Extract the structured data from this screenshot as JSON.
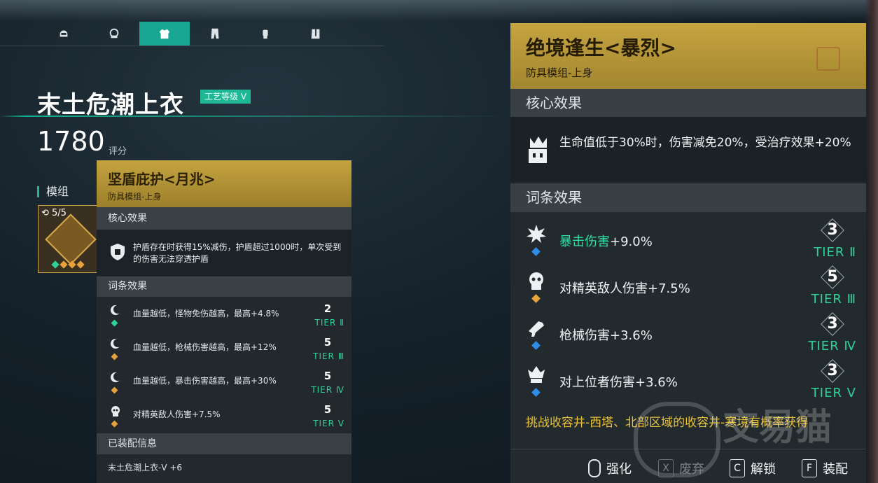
{
  "tabs": [
    {
      "icon": "helmet-icon"
    },
    {
      "icon": "mask-icon"
    },
    {
      "icon": "top-armor-icon",
      "active": true
    },
    {
      "icon": "pants-icon"
    },
    {
      "icon": "gloves-icon"
    },
    {
      "icon": "boots-icon"
    }
  ],
  "item": {
    "title": "末土危潮上衣",
    "craft_badge": "工艺等级 V",
    "score": "1780",
    "score_label": "评分",
    "module_label": "模组",
    "module_count": "5/5"
  },
  "left_popup": {
    "title": "坚盾庇护<月兆>",
    "subtitle": "防具模组-上身",
    "core_header": "核心效果",
    "core_text": "护盾存在时获得15%减伤，护盾超过1000时，单次受到的伤害无法穿透护盾",
    "affix_header": "词条效果",
    "affixes": [
      {
        "text": "血量越低，怪物免伤越高，最高+4.8%",
        "num": "2",
        "tier": "TIER Ⅱ",
        "color": "#2fd19a"
      },
      {
        "text": "血量越低，枪械伤害越高，最高+12%",
        "num": "5",
        "tier": "TIER Ⅲ",
        "color": "#e8a23a"
      },
      {
        "text": "血量越低，暴击伤害越高，最高+30%",
        "num": "5",
        "tier": "TIER Ⅳ",
        "color": "#e8a23a"
      },
      {
        "text": "对精英敌人伤害+7.5%",
        "num": "5",
        "tier": "TIER Ⅴ",
        "color": "#e8a23a"
      }
    ],
    "equip_header": "已装配信息",
    "equip_text": "末土危潮上衣-V +6"
  },
  "right_popup": {
    "title": "绝境逢生<暴烈>",
    "subtitle": "防具模组-上身",
    "core_header": "核心效果",
    "core_text": "生命值低于30%时，伤害减免20%，受治疗效果+20%",
    "affix_header": "词条效果",
    "affixes": [
      {
        "highlight": "暴击伤害",
        "text": "+9.0%",
        "num": "3",
        "tier": "TIER Ⅱ",
        "color": "#2f8be8"
      },
      {
        "highlight": "",
        "text": "对精英敌人伤害+7.5%",
        "num": "5",
        "tier": "TIER Ⅲ",
        "color": "#e8a23a"
      },
      {
        "highlight": "",
        "text": "枪械伤害+3.6%",
        "num": "3",
        "tier": "TIER Ⅳ",
        "color": "#2f8be8"
      },
      {
        "highlight": "",
        "text": "对上位者伤害+3.6%",
        "num": "3",
        "tier": "TIER Ⅴ",
        "color": "#2f8be8"
      }
    ],
    "source": "挑战收容井-西塔、北部区域的收容井-寒境有概率获得"
  },
  "controls": {
    "enhance": "强化",
    "discard_key": "X",
    "discard": "废弃",
    "unlock_key": "C",
    "unlock": "解锁",
    "equip_key": "F",
    "equip": "装配"
  },
  "watermark": "交易猫",
  "colors": {
    "accent": "#17a793",
    "gold": "#c4a33f",
    "tier_green": "#2fd19a",
    "source_yellow": "#e8c23a"
  }
}
